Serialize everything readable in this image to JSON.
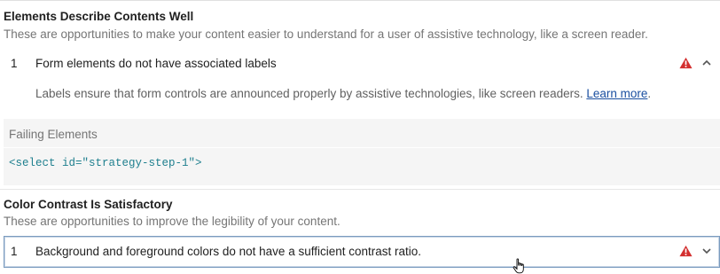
{
  "sections": [
    {
      "title": "Elements Describe Contents Well",
      "description": "These are opportunities to make your content easier to understand for a user of assistive technology, like a screen reader.",
      "audits": [
        {
          "index": "1",
          "title": "Form elements do not have associated labels",
          "status_icon": "warning-triangle-icon",
          "expand_icon": "chevron-up-icon",
          "expanded": true,
          "help_text": "Labels ensure that form controls are announced properly by assistive technologies, like screen readers.",
          "learn_more_label": "Learn more",
          "help_suffix": ".",
          "failing_elements_header": "Failing Elements",
          "failing_elements": [
            "<select id=\"strategy-step-1\">"
          ]
        }
      ]
    },
    {
      "title": "Color Contrast Is Satisfactory",
      "description": "These are opportunities to improve the legibility of your content.",
      "audits": [
        {
          "index": "1",
          "title": "Background and foreground colors do not have a sufficient contrast ratio.",
          "status_icon": "warning-triangle-icon",
          "expand_icon": "chevron-down-icon",
          "expanded": false
        }
      ]
    }
  ],
  "colors": {
    "warning": "#d32f2f",
    "link": "#1a4fa0",
    "code": "#1e7f8e",
    "muted_text": "#757575"
  }
}
